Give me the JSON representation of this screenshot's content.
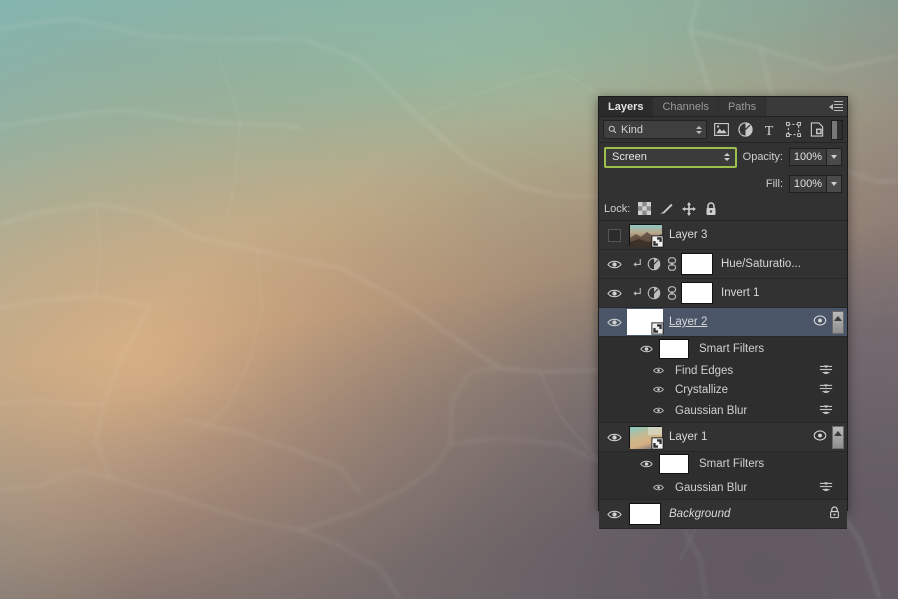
{
  "panel": {
    "tabs": [
      {
        "label": "Layers",
        "active": true
      },
      {
        "label": "Channels",
        "active": false
      },
      {
        "label": "Paths",
        "active": false
      }
    ],
    "menu_icon": "panel-menu-icon"
  },
  "filter_bar": {
    "kind_label": "Kind",
    "search_icon": "search-icon",
    "type_filters": [
      {
        "name": "pixel-layer-filter-icon"
      },
      {
        "name": "adjustment-layer-filter-icon"
      },
      {
        "name": "type-layer-filter-icon"
      },
      {
        "name": "shape-layer-filter-icon"
      },
      {
        "name": "smart-object-filter-icon"
      }
    ],
    "toggle_name": "filter-enable-toggle"
  },
  "blend_bar": {
    "blend_mode": "Screen",
    "opacity_label": "Opacity:",
    "opacity_value": "100%",
    "fill_label": "Fill:",
    "fill_value": "100%",
    "highlight_color": "#9cbf4e"
  },
  "lock_bar": {
    "label": "Lock:",
    "items": [
      {
        "name": "lock-transparent-pixels-icon"
      },
      {
        "name": "lock-image-pixels-icon"
      },
      {
        "name": "lock-position-icon"
      },
      {
        "name": "lock-all-icon"
      }
    ]
  },
  "layers": [
    {
      "name": "Layer 3",
      "visible": false,
      "selected": false,
      "kind": "smart-object",
      "thumb": "photo"
    },
    {
      "name": "Hue/Saturatio...",
      "visible": true,
      "selected": false,
      "kind": "adjustment",
      "clipped": true,
      "linked": true
    },
    {
      "name": "Invert 1",
      "visible": true,
      "selected": false,
      "kind": "adjustment",
      "clipped": true,
      "linked": true
    },
    {
      "name": "Layer 2",
      "visible": true,
      "selected": true,
      "kind": "smart-object",
      "thumb": "white",
      "smart_filters_label": "Smart Filters",
      "filters": [
        "Find Edges",
        "Crystallize",
        "Gaussian Blur"
      ]
    },
    {
      "name": "Layer 1",
      "visible": true,
      "selected": false,
      "kind": "smart-object",
      "thumb": "gradient",
      "smart_filters_label": "Smart Filters",
      "filters": [
        "Gaussian Blur"
      ]
    },
    {
      "name": "Background",
      "visible": true,
      "selected": false,
      "kind": "background",
      "locked": true,
      "thumb": "white"
    }
  ],
  "colors": {
    "panel_bg": "#2b2b2b",
    "row_bg": "#323232",
    "selected_row": "#4a5568",
    "text": "#d8d8d8",
    "accent_green": "#9cbf4e"
  }
}
